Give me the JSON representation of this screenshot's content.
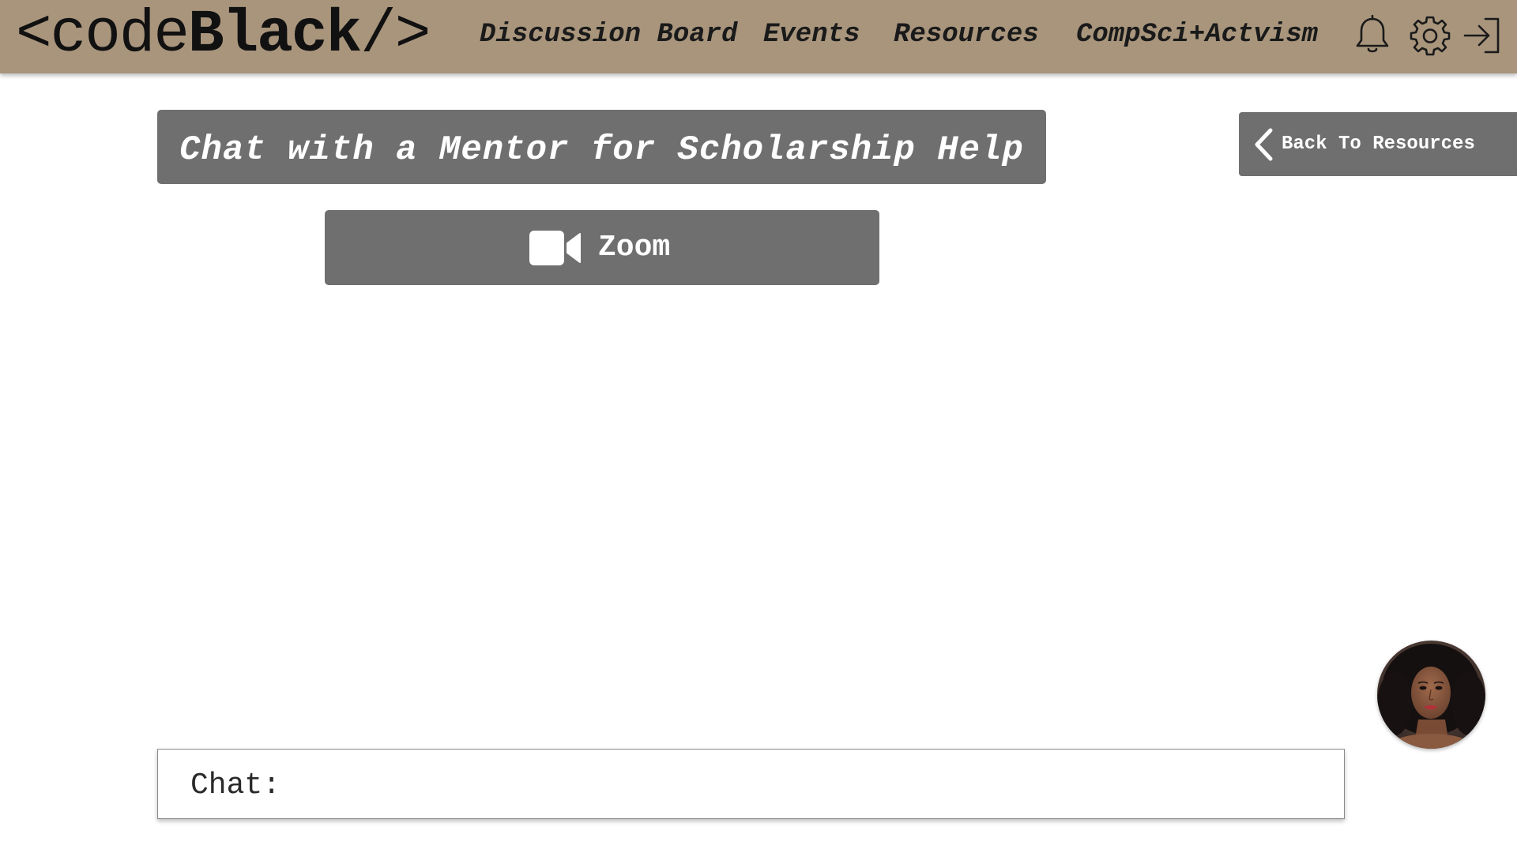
{
  "header": {
    "logo": {
      "prefix": "<code",
      "bold": "Black",
      "suffix": "/>"
    },
    "nav": {
      "discussion": "Discussion Board",
      "events": "Events",
      "resources": "Resources",
      "activism": "CompSci+Actvism"
    },
    "icons": [
      "bell-icon",
      "gear-icon",
      "logout-icon"
    ],
    "background_color": "#a8957c"
  },
  "main": {
    "title": "Chat with a Mentor for Scholarship Help",
    "back_button_label": "Back To Resources",
    "zoom_button_label": "Zoom",
    "chat_label": "Chat:",
    "button_color": "#6f6f6f"
  }
}
